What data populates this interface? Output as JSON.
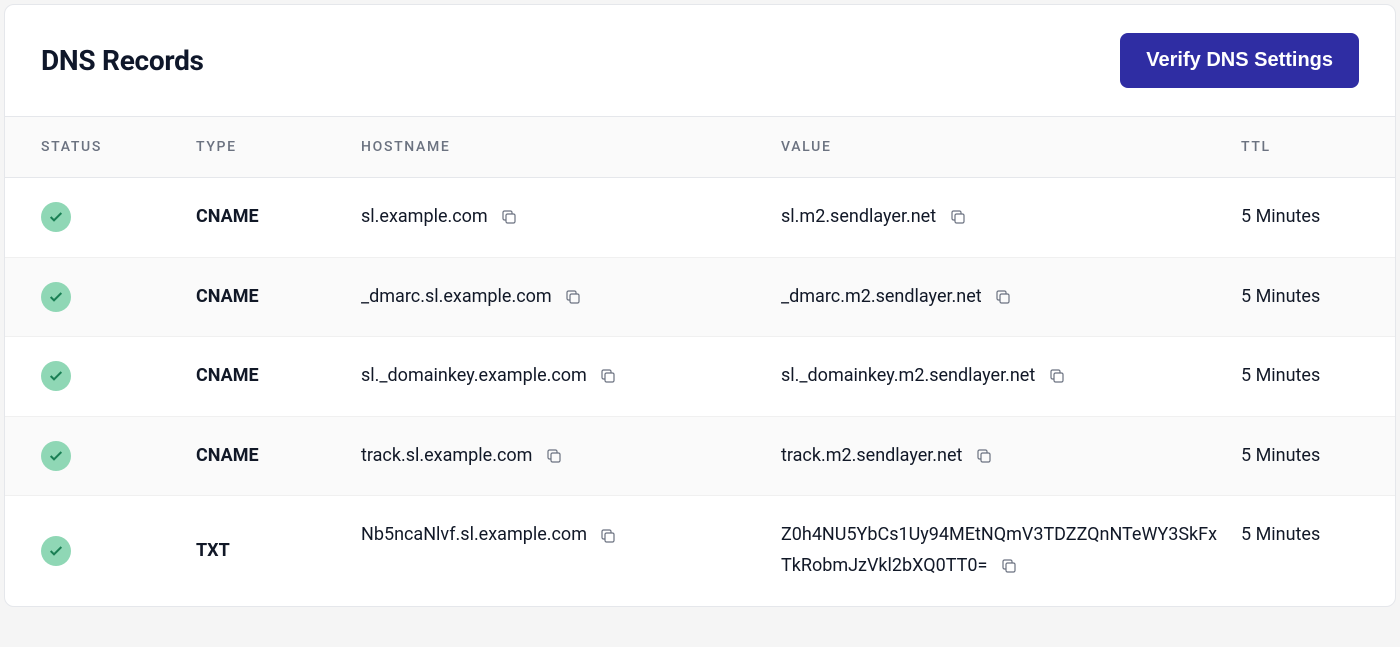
{
  "header": {
    "title": "DNS Records",
    "verify_button": "Verify DNS Settings"
  },
  "columns": {
    "status": "STATUS",
    "type": "TYPE",
    "hostname": "HOSTNAME",
    "value": "VALUE",
    "ttl": "TTL"
  },
  "records": [
    {
      "status": "verified",
      "type": "CNAME",
      "hostname": "sl.example.com",
      "value": "sl.m2.sendlayer.net",
      "ttl": "5 Minutes"
    },
    {
      "status": "verified",
      "type": "CNAME",
      "hostname": "_dmarc.sl.example.com",
      "value": "_dmarc.m2.sendlayer.net",
      "ttl": "5 Minutes"
    },
    {
      "status": "verified",
      "type": "CNAME",
      "hostname": "sl._domainkey.example.com",
      "value": "sl._domainkey.m2.sendlayer.net",
      "ttl": "5 Minutes"
    },
    {
      "status": "verified",
      "type": "CNAME",
      "hostname": "track.sl.example.com",
      "value": "track.m2.sendlayer.net",
      "ttl": "5 Minutes"
    },
    {
      "status": "verified",
      "type": "TXT",
      "hostname": "Nb5ncaNlvf.sl.example.com",
      "value": "Z0h4NU5YbCs1Uy94MEtNQmV3TDZZQnNTeWY3SkFxTkRobmJzVkl2bXQ0TT0=",
      "ttl": "5 Minutes"
    }
  ]
}
